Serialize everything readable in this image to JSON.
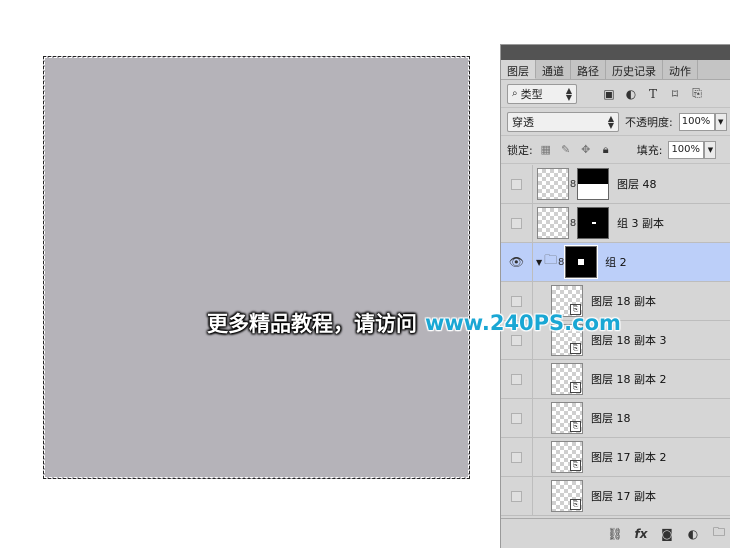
{
  "tabs": [
    "图层",
    "通道",
    "路径",
    "历史记录",
    "动作"
  ],
  "filter": {
    "kind_label": "类型",
    "icons": [
      "image-filter-icon",
      "adjustment-filter-icon",
      "type-filter-icon",
      "shape-filter-icon",
      "smartobject-filter-icon"
    ]
  },
  "blend": {
    "mode": "穿透",
    "opacity_label": "不透明度:",
    "opacity_value": "100%"
  },
  "lock": {
    "label": "锁定:",
    "fill_label": "填充:",
    "fill_value": "100%"
  },
  "layers": [
    {
      "name": "图层 48",
      "visible": false,
      "type": "layer-with-mask"
    },
    {
      "name": "组 3 副本",
      "visible": false,
      "type": "group-copy"
    },
    {
      "name": "组 2",
      "visible": true,
      "type": "group",
      "selected": true
    },
    {
      "name": "图层 18 副本",
      "visible": false,
      "type": "smart"
    },
    {
      "name": "图层 18 副本 3",
      "visible": false,
      "type": "smart"
    },
    {
      "name": "图层 18 副本 2",
      "visible": false,
      "type": "smart"
    },
    {
      "name": "图层 18",
      "visible": false,
      "type": "smart"
    },
    {
      "name": "图层 17 副本 2",
      "visible": false,
      "type": "smart"
    },
    {
      "name": "图层 17 副本",
      "visible": false,
      "type": "smart"
    }
  ],
  "watermark": {
    "text": "更多精品教程，请访问",
    "url": "www.240PS.com"
  },
  "colors": {
    "canvas": "#b5b3b9",
    "selected_row": "#bccff9",
    "panel_bg": "#d6d6d6"
  }
}
